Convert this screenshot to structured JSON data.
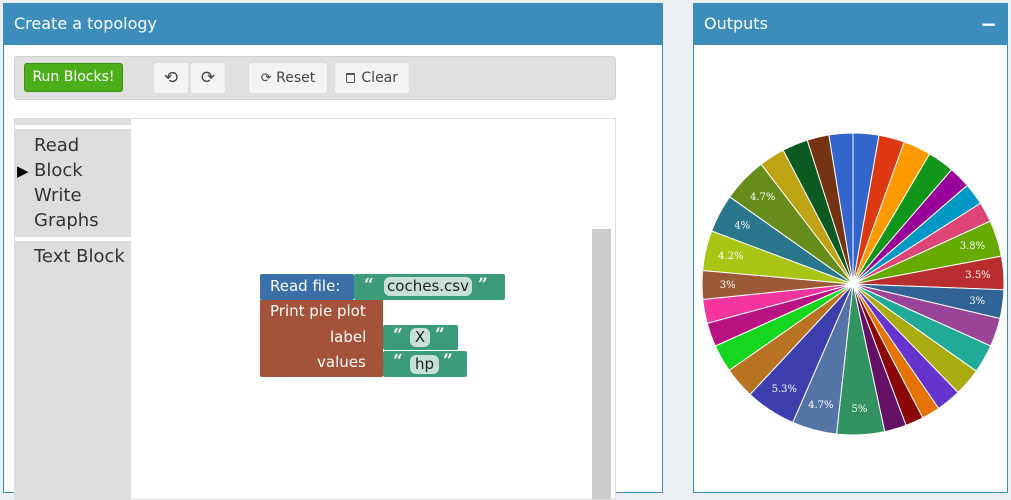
{
  "left_panel": {
    "title": "Create a topology"
  },
  "toolbar": {
    "run_label": "Run Blocks!",
    "undo_icon": "undo-icon",
    "redo_icon": "redo-icon",
    "reset_label": "Reset",
    "clear_label": "Clear"
  },
  "toolbox": {
    "items": [
      {
        "label": "Read"
      },
      {
        "label": "Block",
        "selected": true
      },
      {
        "label": "Write"
      },
      {
        "label": "Graphs"
      },
      {
        "label": "Text Block"
      }
    ]
  },
  "blocks": {
    "read_file": {
      "label": "Read file:",
      "value": "coches.csv",
      "color": "#3a6fa8"
    },
    "pie_plot": {
      "title": "Print pie plot",
      "label_field": "label",
      "label_value": "X",
      "values_field": "values",
      "values_value": "hp",
      "color": "#a5523a"
    },
    "string_color": "#3c9c7a"
  },
  "right_panel": {
    "title": "Outputs",
    "collapse_symbol": "−"
  },
  "chart_data": {
    "type": "pie",
    "start_angle_deg": 0,
    "direction": "clockwise",
    "slices": [
      {
        "value": 2.7,
        "color": "#3366cc"
      },
      {
        "value": 2.7,
        "color": "#dc3912"
      },
      {
        "value": 2.9,
        "color": "#ff9900"
      },
      {
        "value": 2.8,
        "color": "#109618"
      },
      {
        "value": 2.3,
        "color": "#990099"
      },
      {
        "value": 2.3,
        "color": "#0099c6"
      },
      {
        "value": 2.1,
        "color": "#dd4477"
      },
      {
        "value": 3.8,
        "color": "#66aa00",
        "label": "3.8%"
      },
      {
        "value": 3.5,
        "color": "#b82e2e",
        "label": "3.5%"
      },
      {
        "value": 3.0,
        "color": "#316395",
        "label": "3%"
      },
      {
        "value": 3.0,
        "color": "#994499"
      },
      {
        "value": 3.0,
        "color": "#22aa99"
      },
      {
        "value": 2.9,
        "color": "#aaaa11"
      },
      {
        "value": 2.6,
        "color": "#6633cc"
      },
      {
        "value": 1.9,
        "color": "#e67300"
      },
      {
        "value": 1.9,
        "color": "#8b0707"
      },
      {
        "value": 2.3,
        "color": "#651067"
      },
      {
        "value": 5.0,
        "color": "#329262",
        "label": "5%"
      },
      {
        "value": 4.7,
        "color": "#5574a6",
        "label": "4.7%"
      },
      {
        "value": 5.3,
        "color": "#3b3eac",
        "label": "5.3%"
      },
      {
        "value": 3.3,
        "color": "#b77322"
      },
      {
        "value": 2.9,
        "color": "#16d620"
      },
      {
        "value": 2.5,
        "color": "#b91383"
      },
      {
        "value": 2.5,
        "color": "#f4359e"
      },
      {
        "value": 3.0,
        "color": "#9c5935",
        "label": "3%"
      },
      {
        "value": 4.2,
        "color": "#a9c413",
        "label": "4.2%"
      },
      {
        "value": 4.0,
        "color": "#2a778d",
        "label": "4%"
      },
      {
        "value": 4.7,
        "color": "#668d1c",
        "label": "4.7%"
      },
      {
        "value": 2.7,
        "color": "#bea413"
      },
      {
        "value": 2.7,
        "color": "#0c5922"
      },
      {
        "value": 2.3,
        "color": "#743411"
      },
      {
        "value": 2.5,
        "color": "#3366cc"
      }
    ]
  }
}
